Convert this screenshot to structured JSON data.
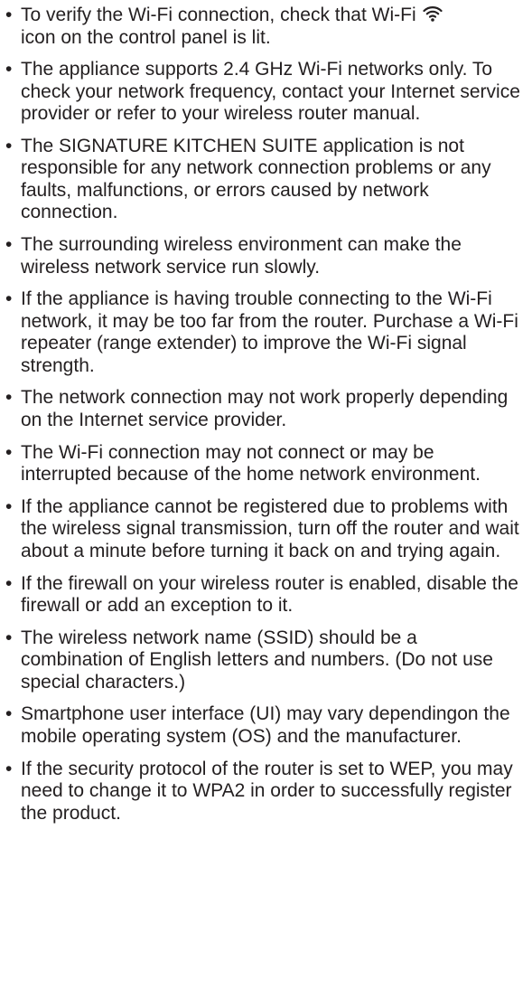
{
  "bullet": "•",
  "notes": [
    {
      "pre_icon": "To verify the Wi-Fi connection, check that Wi-Fi",
      "icon": "wifi-icon",
      "post_icon": "icon on the control panel is lit."
    },
    {
      "text": "The appliance supports 2.4 GHz Wi-Fi networks only. To check your network frequency, contact your Internet service provider or refer to your wireless router manual."
    },
    {
      "text": "The SIGNATURE KITCHEN SUITE application is not responsible for any network connection problems or any faults, malfunctions, or errors caused by network connection."
    },
    {
      "text": "The surrounding wireless environment can make the wireless network service run slowly."
    },
    {
      "text": "If the appliance is having trouble connecting to the Wi-Fi network, it may be too far from the router. Purchase a Wi-Fi repeater (range extender) to improve the Wi-Fi signal strength."
    },
    {
      "text": "The network connection may not work properly depending on the Internet service provider."
    },
    {
      "text": "The Wi-Fi connection may not connect or may be interrupted because of the home network environment."
    },
    {
      "text": "If the appliance cannot be registered due to problems with the wireless signal transmission, turn off the router and wait about a minute before turning it back on and trying again."
    },
    {
      "text": "If the firewall on your wireless router is enabled, disable the firewall or add an exception to it."
    },
    {
      "text": "The wireless network name (SSID) should be a combination of English letters and numbers. (Do not use special characters.)"
    },
    {
      "text": "Smartphone user interface (UI) may vary dependingon the mobile operating system (OS) and the manufacturer."
    },
    {
      "text": "If the security protocol of the router is set to WEP, you may need to change it to WPA2 in order to successfully register the product."
    }
  ]
}
